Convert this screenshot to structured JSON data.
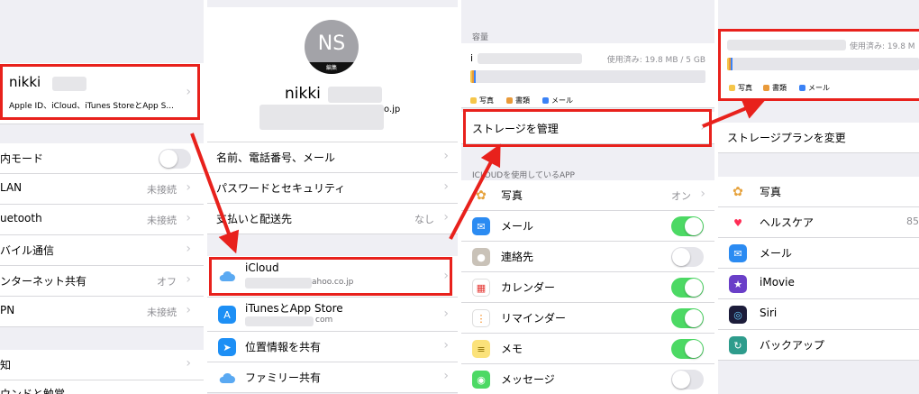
{
  "panel1": {
    "profile_name": "nikki",
    "profile_sub": "Apple ID、iCloud、iTunes StoreとApp S...",
    "rows": [
      {
        "label": "内モード",
        "value": ""
      },
      {
        "label": "LAN",
        "value": "未接続"
      },
      {
        "label": "uetooth",
        "value": "未接続"
      },
      {
        "label": "バイル通信",
        "value": ""
      },
      {
        "label": "ンターネット共有",
        "value": "オフ"
      },
      {
        "label": "PN",
        "value": "未接続"
      },
      {
        "label": "知",
        "value": ""
      },
      {
        "label": "ウンドと触覚",
        "value": ""
      }
    ]
  },
  "panel2": {
    "avatar_initials": "NS",
    "avatar_edit": "編集",
    "name": "nikki",
    "email_tail": "o.jp",
    "rows": [
      {
        "label": "名前、電話番号、メール",
        "value": ""
      },
      {
        "label": "パスワードとセキュリティ",
        "value": ""
      },
      {
        "label": "支払いと配送先",
        "value": "なし"
      }
    ],
    "icloud_label": "iCloud",
    "icloud_sub": "ahoo.co.jp",
    "appstore_label": "iTunesとApp Store",
    "appstore_sub": "com",
    "location_label": "位置情報を共有",
    "family_label": "ファミリー共有"
  },
  "panel3": {
    "section_storage": "容量",
    "storage_letter": "i",
    "storage_used": "使用済み: 19.8 MB / 5 GB",
    "legend": [
      "写真",
      "書類",
      "メール"
    ],
    "manage_label": "ストレージを管理",
    "section_apps": "ICLOUDを使用しているAPP",
    "apps": [
      {
        "label": "写真",
        "value": "オン",
        "toggle": "none"
      },
      {
        "label": "メール",
        "value": "",
        "toggle": "on"
      },
      {
        "label": "連絡先",
        "value": "",
        "toggle": "off"
      },
      {
        "label": "カレンダー",
        "value": "",
        "toggle": "on"
      },
      {
        "label": "リマインダー",
        "value": "",
        "toggle": "on"
      },
      {
        "label": "メモ",
        "value": "",
        "toggle": "on"
      },
      {
        "label": "メッセージ",
        "value": "",
        "toggle": "off"
      }
    ]
  },
  "panel4": {
    "storage_used": "使用済み: 19.8 M",
    "legend": [
      "写真",
      "書類",
      "メール"
    ],
    "change_plan": "ストレージプランを変更",
    "apps": [
      {
        "label": "写真",
        "value": ""
      },
      {
        "label": "ヘルスケア",
        "value": "85"
      },
      {
        "label": "メール",
        "value": ""
      },
      {
        "label": "iMovie",
        "value": ""
      },
      {
        "label": "Siri",
        "value": ""
      },
      {
        "label": "バックアップ",
        "value": ""
      }
    ]
  },
  "colors": {
    "highlight": "#e8211c",
    "toggle_on": "#4cd964",
    "photos": "#f5c64a",
    "docs": "#e99a3a",
    "mail": "#3b82f6"
  }
}
